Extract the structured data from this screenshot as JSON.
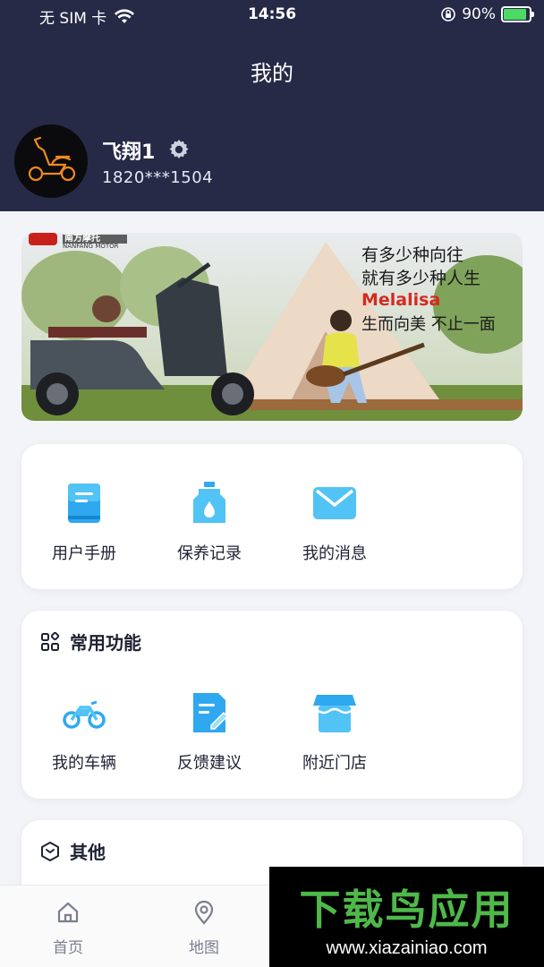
{
  "status_bar": {
    "carrier": "无 SIM 卡",
    "time": "14:56",
    "battery": "90%",
    "battery_level": 0.9
  },
  "page": {
    "title": "我的"
  },
  "profile": {
    "name": "飞翔1",
    "phone": "1820***1504"
  },
  "banner": {
    "brand": "南方摩托",
    "brand_en": "NANFANG MOTOR",
    "line1": "有多少种向往",
    "line2": "就有多少种人生",
    "product": "Melalisa",
    "slogan": "生而向美 不止一面"
  },
  "quick_actions": [
    {
      "label": "用户手册",
      "icon": "book-icon"
    },
    {
      "label": "保养记录",
      "icon": "oil-bottle-icon"
    },
    {
      "label": "我的消息",
      "icon": "envelope-icon"
    }
  ],
  "common": {
    "title": "常用功能",
    "items": [
      {
        "label": "我的车辆",
        "icon": "motorcycle-icon"
      },
      {
        "label": "反馈建议",
        "icon": "feedback-icon"
      },
      {
        "label": "附近门店",
        "icon": "store-icon"
      }
    ]
  },
  "other": {
    "title": "其他"
  },
  "tabbar": {
    "items": [
      {
        "label": "首页",
        "icon": "home-icon"
      },
      {
        "label": "地图",
        "icon": "map-pin-icon"
      }
    ]
  },
  "watermark": {
    "title": "下载鸟应用",
    "url": "www.xiazainiao.com"
  },
  "colors": {
    "header_bg": "#262a47",
    "accent_blue": "#2fa8ef",
    "page_bg": "#f3f4f8"
  }
}
